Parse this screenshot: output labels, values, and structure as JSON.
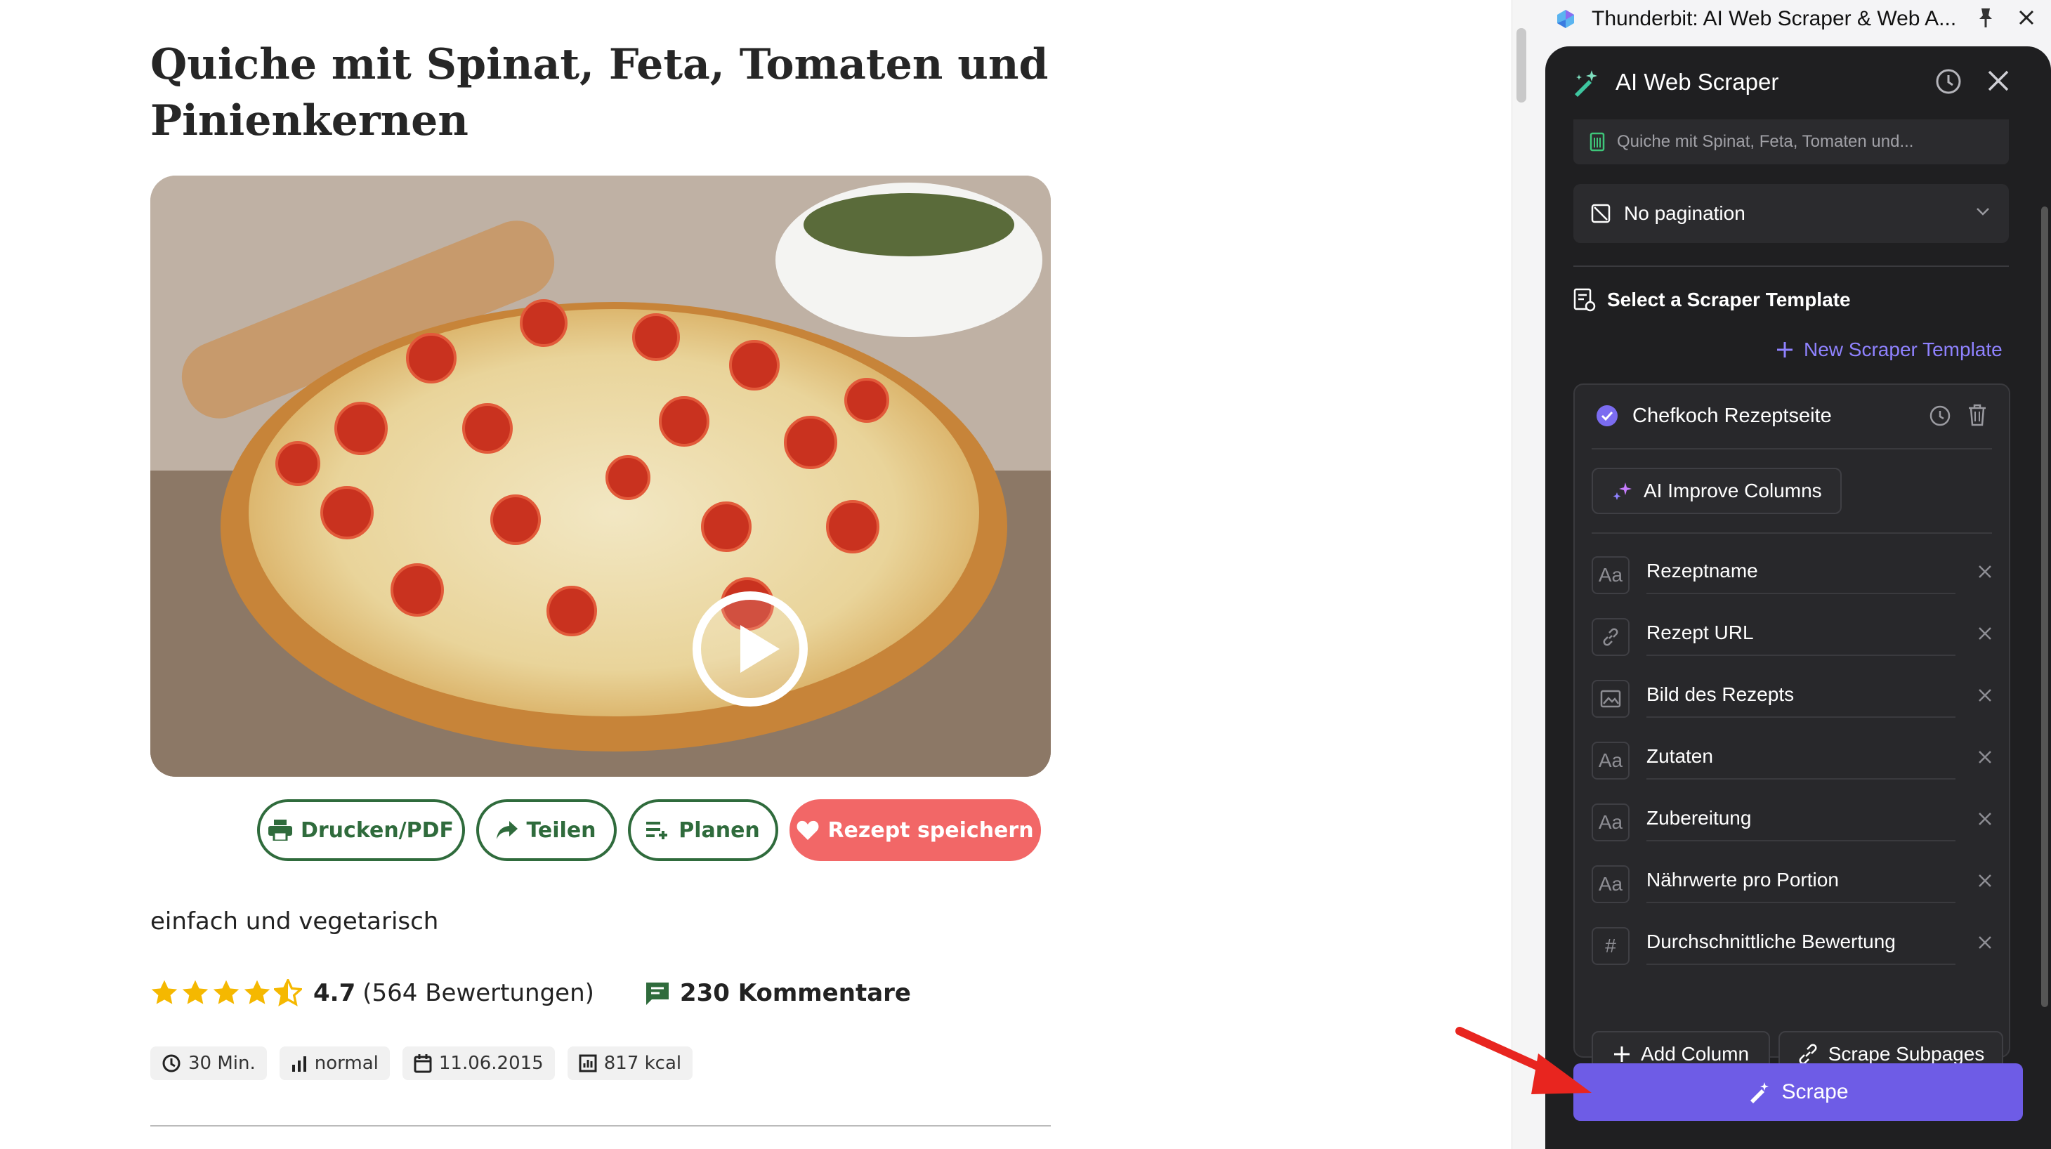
{
  "recipe": {
    "title": "Quiche mit Spinat, Feta, Tomaten und Pinienkernen",
    "actions": {
      "print": "Drucken/PDF",
      "share": "Teilen",
      "plan": "Planen",
      "save": "Rezept speichern"
    },
    "tagline": "einfach und vegetarisch",
    "rating": {
      "value": "4.7",
      "count_text": "(564 Bewertungen)",
      "stars": 4.5
    },
    "comments": "230 Kommentare",
    "meta": {
      "time": "30 Min.",
      "difficulty": "normal",
      "date": "11.06.2015",
      "calories": "817 kcal"
    },
    "colors": {
      "brand_green": "#2f6b3c",
      "save_red": "#f26767",
      "star": "#f5b800"
    }
  },
  "extension": {
    "window_title": "Thunderbit: AI Web Scraper & Web A...",
    "panel_title": "AI Web Scraper",
    "page_url_text": "Quiche mit Spinat, Feta, Tomaten und...",
    "pagination": "No pagination",
    "section_title": "Select a Scraper Template",
    "new_template": "New Scraper Template",
    "template": {
      "name": "Chefkoch Rezeptseite",
      "improve": "AI Improve Columns",
      "columns": [
        {
          "name": "Rezeptname",
          "type_icon": "text-type-icon"
        },
        {
          "name": "Rezept URL",
          "type_icon": "link-type-icon"
        },
        {
          "name": "Bild des Rezepts",
          "type_icon": "image-type-icon"
        },
        {
          "name": "Zutaten",
          "type_icon": "text-type-icon"
        },
        {
          "name": "Zubereitung",
          "type_icon": "text-type-icon"
        },
        {
          "name": "Nährwerte pro Portion",
          "type_icon": "text-type-icon"
        },
        {
          "name": "Durchschnittliche Bewertung",
          "type_icon": "number-type-icon"
        }
      ],
      "add_column": "Add Column",
      "scrape_subpages": "Scrape Subpages"
    },
    "scrape": "Scrape",
    "type_glyphs": {
      "text": "Aa",
      "number": "#"
    },
    "colors": {
      "panel_bg": "#1f1f21",
      "accent": "#6e5ce6",
      "link": "#8f82ff"
    }
  }
}
